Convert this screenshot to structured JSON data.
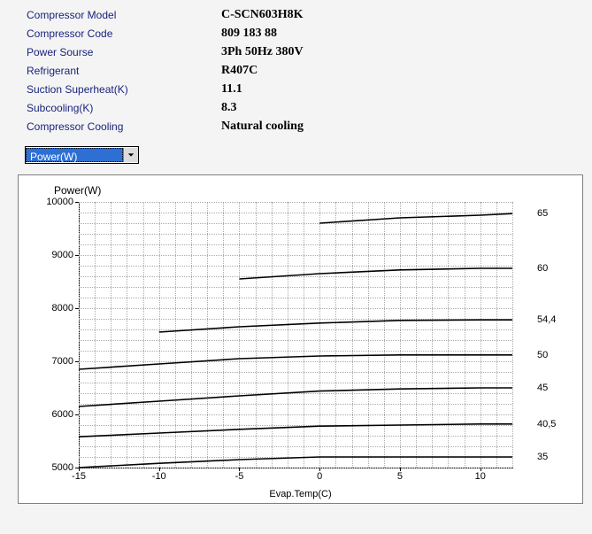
{
  "specs": [
    {
      "label": "Compressor Model",
      "value": "C-SCN603H8K"
    },
    {
      "label": "Compressor Code",
      "value": "809 183 88"
    },
    {
      "label": "Power Sourse",
      "value": "3Ph  50Hz  380V"
    },
    {
      "label": "Refrigerant",
      "value": "R407C"
    },
    {
      "label": "Suction Superheat(K)",
      "value": "11.1"
    },
    {
      "label": "Subcooling(K)",
      "value": "8.3"
    },
    {
      "label": "Compressor Cooling",
      "value": "Natural cooling"
    }
  ],
  "combo": {
    "selected": "Power(W)"
  },
  "chart_data": {
    "type": "line",
    "title": "Power(W)",
    "xlabel": "Evap.Temp(C)",
    "ylabel": "",
    "xlim": [
      -15,
      12
    ],
    "ylim": [
      5000,
      10000
    ],
    "xticks": [
      -15,
      -10,
      -5,
      0,
      5,
      10
    ],
    "yticks": [
      5000,
      6000,
      7000,
      8000,
      9000,
      10000
    ],
    "x": [
      -15,
      -10,
      -5,
      0,
      5,
      10,
      12
    ],
    "series": [
      {
        "name": "35",
        "label_at_x": 12,
        "values": [
          5000,
          5080,
          5150,
          5200,
          5200,
          5200,
          5200
        ]
      },
      {
        "name": "40,5",
        "label_at_x": 12,
        "values": [
          5580,
          5650,
          5720,
          5780,
          5800,
          5820,
          5820
        ]
      },
      {
        "name": "45",
        "label_at_x": 12,
        "values": [
          6150,
          6250,
          6350,
          6440,
          6480,
          6500,
          6500
        ]
      },
      {
        "name": "50",
        "label_at_x": 12,
        "values": [
          6850,
          6950,
          7050,
          7100,
          7120,
          7120,
          7120
        ]
      },
      {
        "name": "54,4",
        "label_at_x": 12,
        "values": [
          null,
          7550,
          7650,
          7720,
          7770,
          7780,
          7780
        ]
      },
      {
        "name": "60",
        "label_at_x": 12,
        "values": [
          null,
          null,
          8550,
          8650,
          8720,
          8750,
          8750
        ]
      },
      {
        "name": "65",
        "label_at_x": 12,
        "values": [
          null,
          null,
          null,
          9600,
          9700,
          9750,
          9780
        ]
      }
    ]
  }
}
